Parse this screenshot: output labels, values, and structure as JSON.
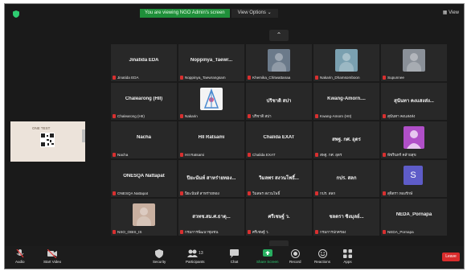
{
  "topbar": {
    "view_label": "You are viewing NGO Admin's screen",
    "view_options": "View Options",
    "layout_label": "View"
  },
  "nav": {
    "up": "⌃",
    "down": "⌄"
  },
  "share": {
    "title": "ONE TEST",
    "colors": {
      "bg": "#ece3da",
      "qr": "#222222"
    }
  },
  "tiles": [
    {
      "name": "Jinatida EDA",
      "label": "Jinatida EDA",
      "type": "name"
    },
    {
      "name": "Noppinya_Taewr...",
      "label": "Noppinya_Taewrangsam",
      "type": "name"
    },
    {
      "name": "",
      "label": "Khemika_Chitwattanaa",
      "type": "photo",
      "color": "#6b7a8a"
    },
    {
      "name": "",
      "label": "Nakarin_Dhamsomboon",
      "type": "photo",
      "color": "#7aa0b0"
    },
    {
      "name": "",
      "label": "Supunnee",
      "type": "photo",
      "color": "#8a9098"
    },
    {
      "name": "Chalearong (HII)",
      "label": "Chalearong (HII)",
      "type": "name"
    },
    {
      "name": "",
      "label": "Nakarin",
      "type": "logo",
      "color": "#f4f4f4"
    },
    {
      "name": "ปริชาติ สปา",
      "label": "ปริชาติ สปา",
      "type": "name"
    },
    {
      "name": "Kwang-Amorn....",
      "label": "Kwang-Amorn (HII)",
      "type": "name"
    },
    {
      "name": "สุนันทา คงแสงส่ง...",
      "label": "สุนันทา คงแสงส่ง",
      "type": "name"
    },
    {
      "name": "Nacha",
      "label": "Nacha",
      "type": "name"
    },
    {
      "name": "HII Ratsami",
      "label": "HII Ratsami",
      "type": "name"
    },
    {
      "name": "Chalida EXAT",
      "label": "Chalida EXAT",
      "type": "name"
    },
    {
      "name": "สพฐ. กศ. อุดร",
      "label": "สพฐ. กศ. อุดร",
      "type": "name"
    },
    {
      "name": "",
      "label": "พัชรินทร์ คล้ายสุข",
      "type": "avatar",
      "color": "#b04fc8"
    },
    {
      "name": "ONESQA Nattapat",
      "label": "ONESQA Nattapat",
      "type": "name"
    },
    {
      "name": "ปิยะนันท์ สาหร่ายทอง...",
      "label": "ปิยะนันท์ สาหร่ายทอง",
      "type": "name"
    },
    {
      "name": "วิมลพร สงวนโพธิ์...",
      "label": "วิมลพร สงวนโพธิ์",
      "type": "name"
    },
    {
      "name": "กปร. สลก",
      "label": "กปร. สลก",
      "type": "name"
    },
    {
      "name": "",
      "label": "สุจิตรา ทองรักษ์",
      "type": "letter",
      "letter": "S",
      "color": "#5e5cc8"
    },
    {
      "name": "",
      "label": "NSO_OBIS_IS",
      "type": "photo",
      "color": "#c9b0a0"
    },
    {
      "name": "สวทช.สม.ศ.ธาตุ...",
      "label": "กรมการพัฒนาชุมชน",
      "type": "name"
    },
    {
      "name": "ศรีเชษฐ์ ว.",
      "label": "ศรีเชษฐ์ ว.",
      "type": "name"
    },
    {
      "name": "ชลดรา ซิงมุลย์...",
      "label": "กรมการปกครอง",
      "type": "name"
    },
    {
      "name": "NEDA_Pornapa",
      "label": "NEDA_Pornapa",
      "type": "name"
    }
  ],
  "toolbar": {
    "audio": "Audio",
    "start_video": "Start Video",
    "security": "Security",
    "participants": "Participants",
    "participants_count": "135",
    "chat": "Chat",
    "share_screen": "Share Screen",
    "record": "Record",
    "reactions": "Reactions",
    "apps": "Apps",
    "leave": "Leave"
  },
  "colors": {
    "accent": "#1f8f3a",
    "leave": "#d92c2c",
    "share_green": "#27ae60",
    "muted_red": "#d83030"
  }
}
